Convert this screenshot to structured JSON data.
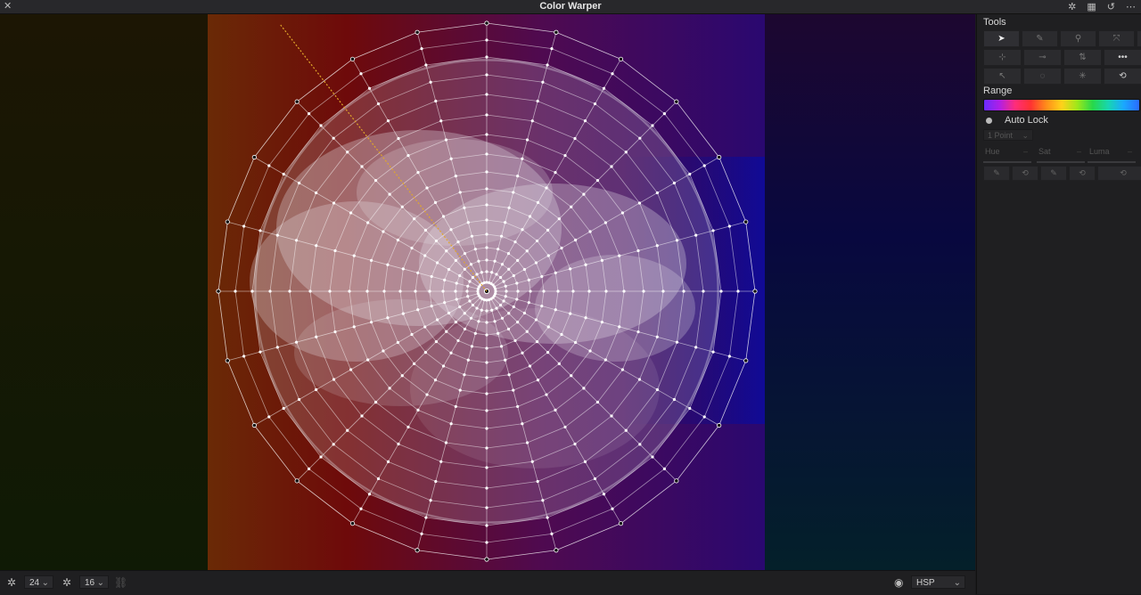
{
  "window": {
    "title": "Color Warper",
    "close_glyph": "✕",
    "title_icons": [
      "color-wheel-icon",
      "grid-icon",
      "history-icon",
      "more-icon"
    ],
    "title_icon_glyphs": [
      "✲",
      "▦",
      "↺",
      "⋯"
    ]
  },
  "viewer": {
    "mode_colors": {
      "red": "#6a0c0c",
      "magenta": "#4b0a55",
      "blue": "#0c0c6e",
      "cyan": "#0b3d52",
      "green": "#0c4a0c",
      "olive": "#3b3408",
      "accent": "#e0a72a"
    }
  },
  "panel": {
    "tools_label": "Tools",
    "tool_rows": [
      [
        {
          "name": "pointer-tool-icon",
          "glyph": "➤",
          "active": true
        },
        {
          "name": "brush-tool-icon",
          "glyph": "✎"
        },
        {
          "name": "pin-tool-icon",
          "glyph": "⚲"
        },
        {
          "name": "collapse-tool-icon",
          "glyph": "⤧"
        },
        {
          "name": "expand-tool-icon",
          "glyph": "⤢"
        }
      ],
      [
        {
          "name": "add-point-icon",
          "glyph": "⊹"
        },
        {
          "name": "remove-point-icon",
          "glyph": "⊸"
        },
        {
          "name": "swap-icon",
          "glyph": "⇅"
        },
        {
          "name": "pin-row-icon",
          "glyph": "•••",
          "bright": true
        }
      ],
      [
        {
          "name": "select-icon",
          "glyph": "↖"
        },
        {
          "name": "select-all-icon",
          "glyph": "◌"
        },
        {
          "name": "radial-icon",
          "glyph": "✳"
        },
        {
          "name": "reset-icon",
          "glyph": "⟲",
          "bright": true
        }
      ]
    ],
    "range_label": "Range",
    "auto_lock_label": "Auto Lock",
    "points_select": "1 Point",
    "sliders": [
      {
        "label": "Hue",
        "value": "–"
      },
      {
        "label": "Sat",
        "value": "–"
      },
      {
        "label": "Luma",
        "value": "–"
      }
    ],
    "action_buttons": [
      "pipette-icon",
      "reset-icon",
      "pipette-icon",
      "reset-icon",
      "reset-icon"
    ]
  },
  "bottom": {
    "res_icon": "color-wheel-icon",
    "res_value": "24",
    "res2_icon": "color-wheel-icon",
    "res2_value": "16",
    "link_icon": "link-icon",
    "mode_icon": "color-swatch-icon",
    "mode_value": "HSP"
  }
}
